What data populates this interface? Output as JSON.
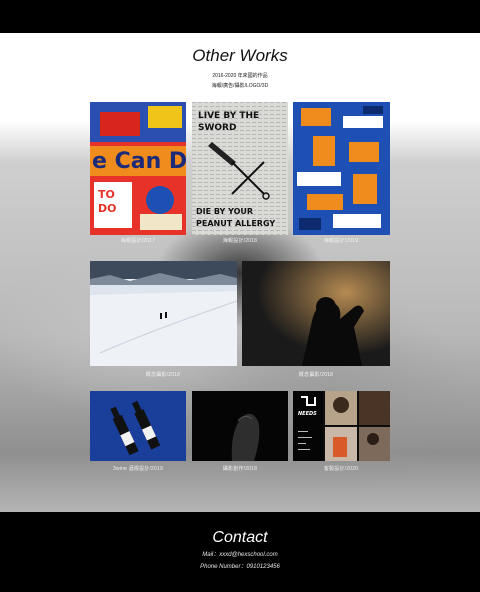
{
  "section": {
    "title": "Other Works",
    "subtitle_1": "2016-2020 年來國的作品",
    "subtitle_2": "海報/廣告/攝影/LOGO/3D"
  },
  "works": [
    {
      "caption": "海報設計/2017",
      "icon": "poster-collage-image"
    },
    {
      "caption": "海報設計/2018",
      "icon": "poster-sword-image"
    },
    {
      "caption": "海報設計/2019",
      "icon": "poster-abstract-image"
    },
    {
      "caption": "概念攝影/2018",
      "icon": "snow-field-photo"
    },
    {
      "caption": "概念攝影/2018",
      "icon": "silhouette-photo"
    },
    {
      "caption": "3wine 酒標設計/2019",
      "icon": "wine-bottles-photo"
    },
    {
      "caption": "攝影創作/2018",
      "icon": "dark-portrait-photo"
    },
    {
      "caption": "客製設計/2020",
      "icon": "needs-brand-collage"
    }
  ],
  "contact": {
    "title": "Contact",
    "mail": "Mail：xxxd@hexschool.com",
    "phone": "Phone Number：0910123456"
  },
  "colors": {
    "background": "#000000",
    "accent_blue": "#1e50b4",
    "accent_orange": "#f08c1e",
    "accent_red": "#e63228"
  }
}
